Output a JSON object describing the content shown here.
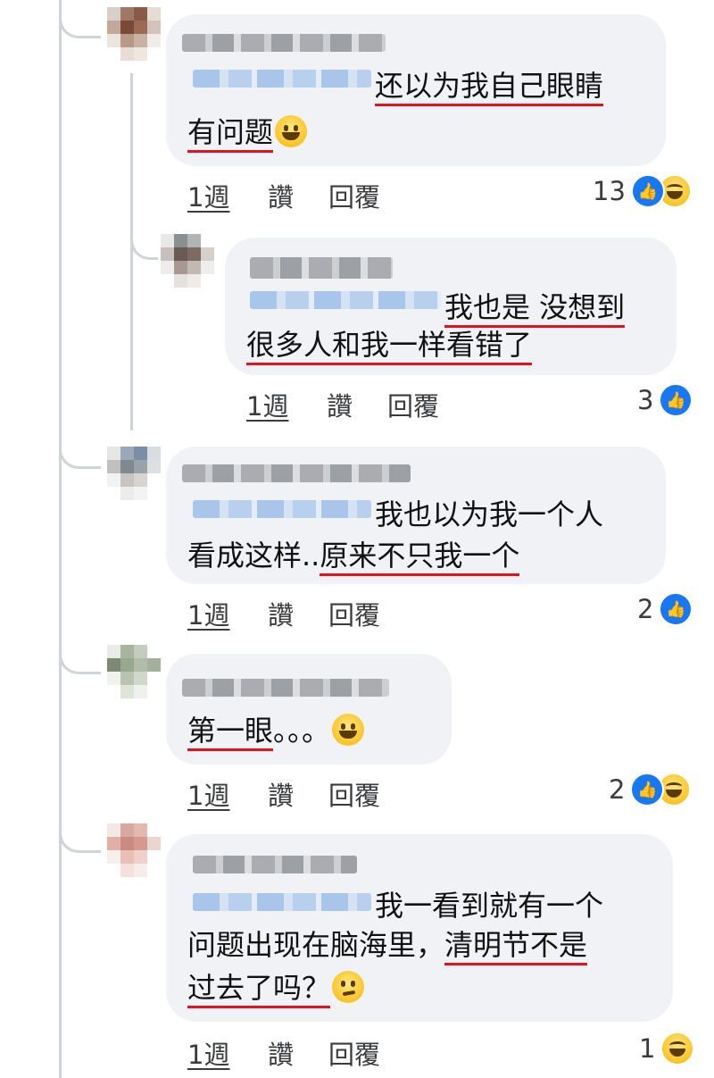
{
  "comments": [
    {
      "text_lines": [
        {
          "pre": "",
          "underlined": "还以为我自己眼睛",
          "post": ""
        },
        {
          "pre": "",
          "underlined": "有问题",
          "post": "",
          "emoji": "sweat-smile-emoji"
        }
      ],
      "time": "1週",
      "like": "讚",
      "reply": "回覆",
      "reaction_count": "13",
      "reactions": [
        "like-icon",
        "haha-icon"
      ]
    },
    {
      "text_lines": [
        {
          "pre": "",
          "underlined": "我也是 没想到",
          "post": ""
        },
        {
          "pre": "",
          "underlined": "很多人和我一样看错了",
          "post": ""
        }
      ],
      "time": "1週",
      "like": "讚",
      "reply": "回覆",
      "reaction_count": "3",
      "reactions": [
        "like-icon"
      ]
    },
    {
      "text_lines": [
        {
          "pre": "我也以为我一个人",
          "underlined": "",
          "post": ""
        },
        {
          "pre": "看成这样..",
          "underlined": "原来不只我一个",
          "post": ""
        }
      ],
      "time": "1週",
      "like": "讚",
      "reply": "回覆",
      "reaction_count": "2",
      "reactions": [
        "like-icon"
      ]
    },
    {
      "text_lines": [
        {
          "pre": "",
          "underlined": "第一眼",
          "post": "。。。",
          "emoji": "laughing-tears-emoji"
        }
      ],
      "time": "1週",
      "like": "讚",
      "reply": "回覆",
      "reaction_count": "2",
      "reactions": [
        "like-icon",
        "haha-icon"
      ]
    },
    {
      "text_lines": [
        {
          "pre": "我一看到就有一个",
          "underlined": "",
          "post": ""
        },
        {
          "pre": "问题出现在脑海里，",
          "underlined": "清明节不是",
          "post": ""
        },
        {
          "pre": "",
          "underlined": "过去了吗？",
          "post": "",
          "emoji": "thinking-emoji"
        }
      ],
      "time": "1週",
      "like": "讚",
      "reply": "回覆",
      "reaction_count": "1",
      "reactions": [
        "haha-icon"
      ]
    }
  ],
  "colors": {
    "bubble": "#f0f2f5",
    "underline": "#e0141c",
    "like": "#1877f2",
    "thread": "#d0d3d8"
  }
}
